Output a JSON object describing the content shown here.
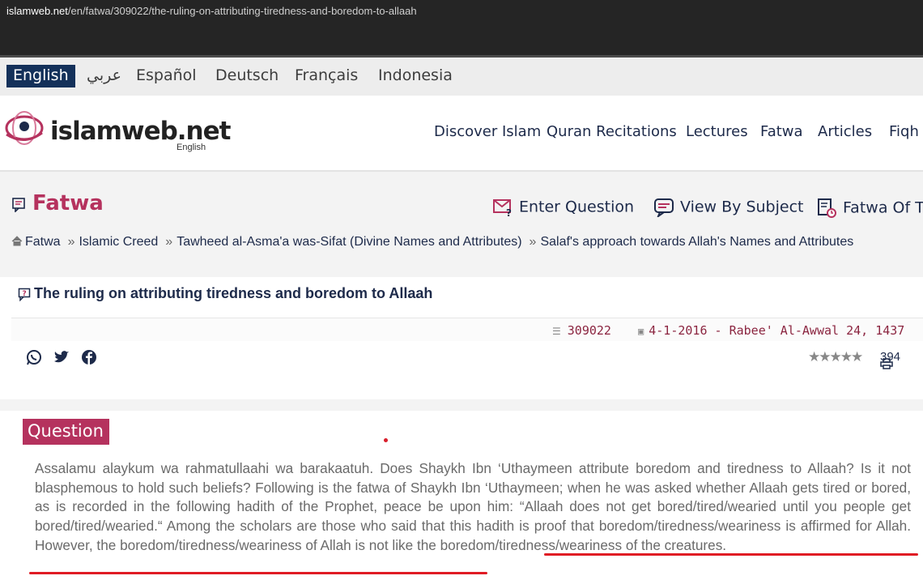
{
  "browser": {
    "url_host": "islamweb.net",
    "url_path": "/en/fatwa/309022/the-ruling-on-attributing-tiredness-and-boredom-to-allaah"
  },
  "languages": [
    {
      "label": "English",
      "active": true
    },
    {
      "label": "عربي"
    },
    {
      "label": "Español"
    },
    {
      "label": "Deutsch"
    },
    {
      "label": "Français"
    },
    {
      "label": "Indonesia"
    }
  ],
  "logo": {
    "name": "islamweb.net",
    "sub": "English"
  },
  "nav": [
    "Discover Islam",
    "Quran Recitations",
    "Lectures",
    "Fatwa",
    "Articles",
    "Fiqh"
  ],
  "section": {
    "title": "Fatwa",
    "actions": [
      "Enter Question",
      "View By Subject",
      "Fatwa Of Th"
    ]
  },
  "breadcrumbs": [
    "Fatwa",
    "Islamic Creed",
    "Tawheed al-Asma'a was-Sifat (Divine Names and Attributes)",
    "Salaf's approach towards Allah's Names and Attributes"
  ],
  "fatwa": {
    "title": "The ruling on attributing tiredness and boredom to Allaah",
    "id": "309022",
    "date": "4-1-2016 - Rabee' Al-Awwal 24, 1437",
    "views": "394"
  },
  "question": {
    "label": "Question",
    "text": "Assalamu alaykum wa rahmatullaahi wa barakaatuh. Does Shaykh Ibn ‘Uthaymeen attribute boredom and tiredness to Allaah? Is it not blasphemous to hold such beliefs? Following is the fatwa of Shaykh Ibn ‘Uthaymeen; when he was asked whether Allaah gets tired or bored, as is recorded in the following hadith of the Prophet, peace be upon him: “Allaah does not get bored/tired/wearied until you people get bored/tired/wearied.“ Among the scholars are those who said that this hadith is proof that boredom/tiredness/weariness is affirmed for Allah. However, the boredom/tiredness/weariness of Allah is not like the boredom/tiredness/weariness of the creatures."
  },
  "colors": {
    "accent": "#b5325e",
    "navy": "#14315a",
    "underline": "#e01b24"
  }
}
